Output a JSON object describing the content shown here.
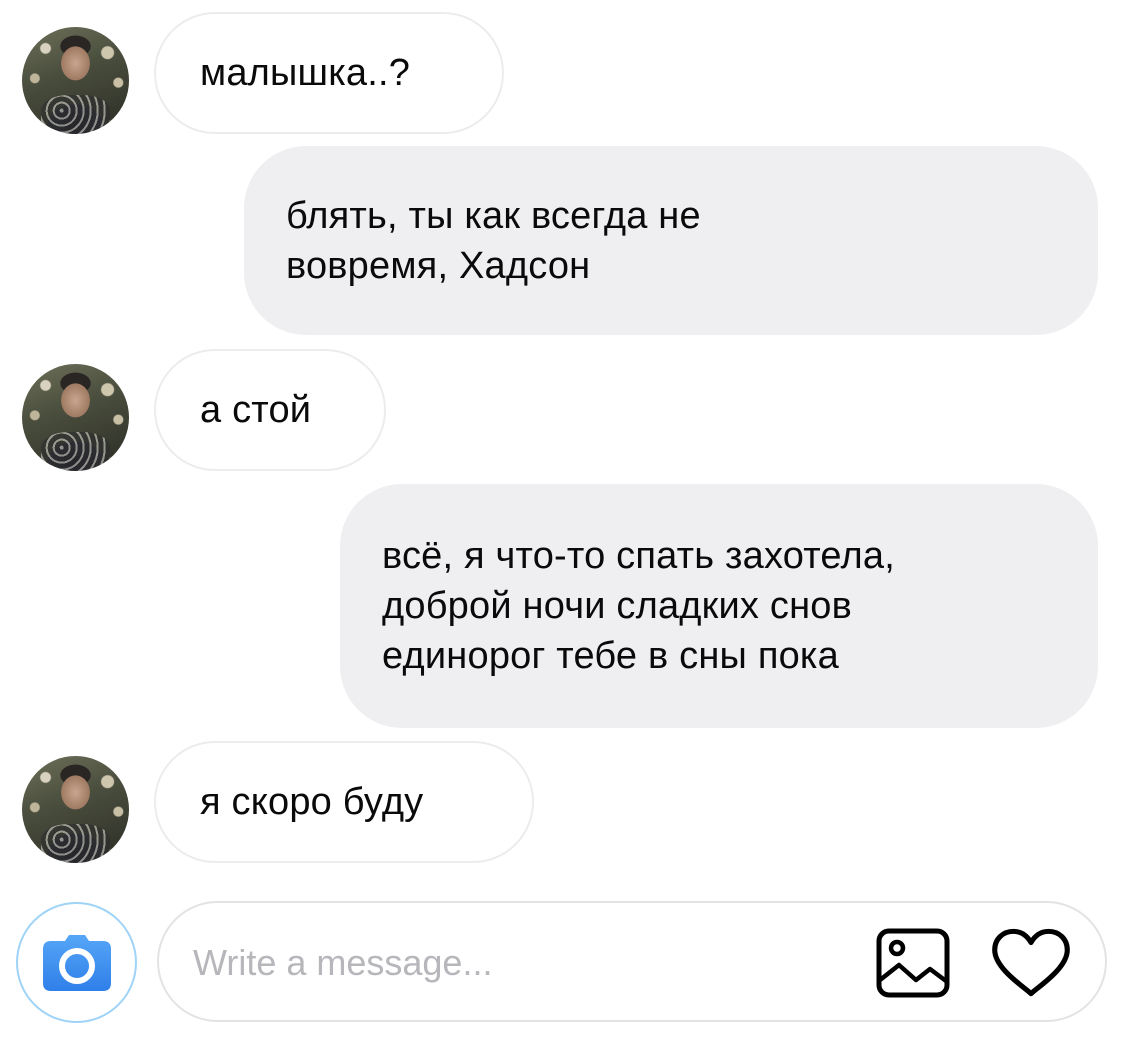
{
  "messages": [
    {
      "id": "m1",
      "direction": "incoming",
      "text": "малышка..?"
    },
    {
      "id": "m2",
      "direction": "outgoing",
      "text": "блять, ты как всегда не\nвовремя, Хадсон"
    },
    {
      "id": "m3",
      "direction": "incoming",
      "text": "а стой"
    },
    {
      "id": "m4",
      "direction": "outgoing",
      "text": "всё, я что-то спать захотела,\nдоброй ночи сладких снов\nединорог тебе в сны пока"
    },
    {
      "id": "m5",
      "direction": "incoming",
      "text": "я скоро буду"
    }
  ],
  "composer": {
    "placeholder": "Write a message...",
    "value": "",
    "camera_icon": "camera-icon",
    "gallery_icon": "image-gallery-icon",
    "like_icon": "heart-icon"
  },
  "colors": {
    "camera_accent": "#3b8ff5",
    "outgoing_bubble": "#efeff2",
    "incoming_border": "#ececee"
  }
}
